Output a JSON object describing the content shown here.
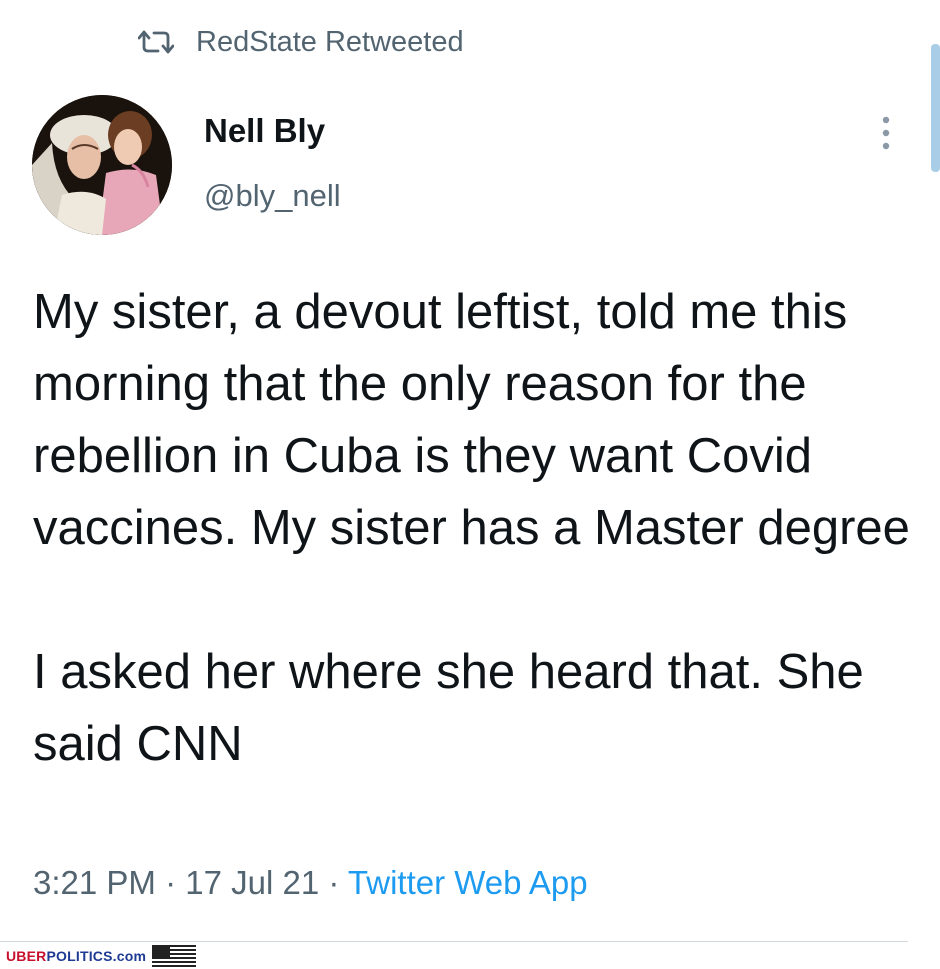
{
  "retweet": {
    "icon": "retweet-icon",
    "label": "RedState Retweeted"
  },
  "author": {
    "name": "Nell Bly",
    "handle": "@bly_nell",
    "avatar": "profile-photo"
  },
  "more_icon": "more-vertical-icon",
  "tweet": {
    "paragraph_1": "My sister, a devout leftist, told me this morning that the only reason for the rebellion in Cuba is they want Covid vaccines. My sister has a Master degree",
    "paragraph_2": "I asked her where she heard that. She said CNN"
  },
  "meta": {
    "time": "3:21 PM",
    "separator_1": " · ",
    "date": "17 Jul 21",
    "separator_2": " · ",
    "source": "Twitter Web App"
  },
  "watermark": {
    "part_1": "UBER",
    "part_2": "POLITICS.com",
    "flag_icon": "us-flag-icon"
  },
  "colors": {
    "primary_text": "#0f1419",
    "secondary_text": "#536471",
    "link_blue": "#1d9bf0",
    "watermark_red": "#c8102e",
    "watermark_blue": "#1f3a93"
  }
}
